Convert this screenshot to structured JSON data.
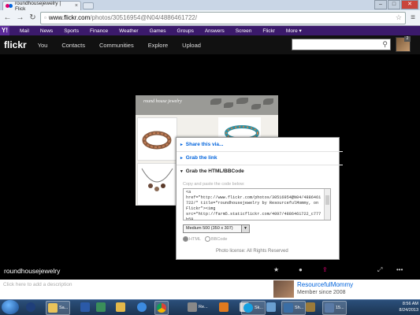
{
  "browser": {
    "tab_title": "roundhousejewelry | Flick",
    "tab_close": "×",
    "url_host": "www.flickr.com",
    "url_path": "/photos/30516954@N04/4886461722/",
    "window_buttons": [
      "–",
      "□",
      "✕"
    ]
  },
  "yahoo_bar": {
    "logo": "Y!",
    "items": [
      "Mail",
      "News",
      "Sports",
      "Finance",
      "Weather",
      "Games",
      "Groups",
      "Answers",
      "Screen",
      "Flickr",
      "More ▾"
    ]
  },
  "flickr_header": {
    "logo": "flickr",
    "nav": [
      "You",
      "Contacts",
      "Communities",
      "Explore",
      "Upload"
    ],
    "notification_count": "2"
  },
  "photo": {
    "brand_text": "round house jewelry"
  },
  "share_dialog": {
    "sections": [
      "Share this via...",
      "Grab the link",
      "Grab the HTML/BBCode"
    ],
    "copy_hint": "Copy and paste the code below:",
    "code": "<a\nhref=\"http://www.flickr.com/photos/30516954@N04/4886461\n722/\" title=\"roundhousejewelry by ResourcefulMommy, on\nFlickr\"><img\nsrc=\"http://farm5.staticflickr.com/4097/4886461722_c777b59",
    "size_option": "Medium 500 (350 x 307)",
    "formats": [
      "HTML",
      "BBCode"
    ],
    "license": "Photo license:  All Rights Reserved"
  },
  "photo_info": {
    "title": "roundhousejewelry",
    "description_placeholder": "Click here to add a description",
    "owner_name": "ResourcefulMommy",
    "member_since": "Member since 2008"
  },
  "taskbar": {
    "buttons": [
      "Sa...",
      "",
      "",
      "",
      "",
      "Re...",
      "",
      "",
      "Sk...",
      "",
      "Sh...",
      "",
      "15..."
    ],
    "clock_time": "8:56 AM",
    "clock_date": "8/24/2013"
  }
}
